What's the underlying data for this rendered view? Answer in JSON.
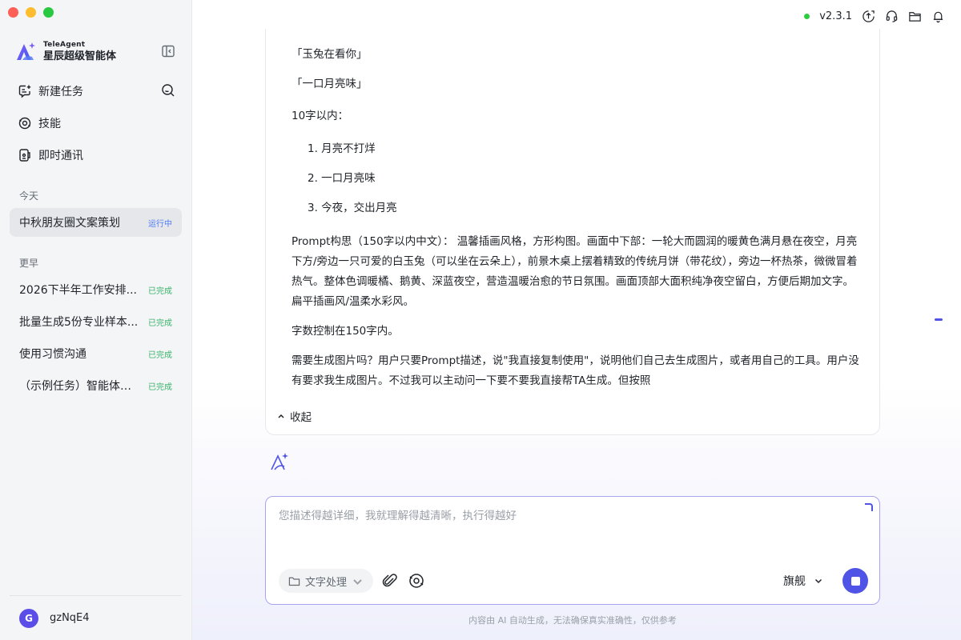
{
  "app": {
    "brand_small": "TeleAgent",
    "brand_big": "星辰超级智能体",
    "version": "v2.3.1",
    "accent_color": "#4f54e6",
    "status_color": "#2ecc40"
  },
  "sidebar": {
    "nav": [
      {
        "label": "新建任务",
        "icon": "new-task-icon"
      },
      {
        "label": "技能",
        "icon": "skill-icon"
      },
      {
        "label": "即时通讯",
        "icon": "chat-icon"
      }
    ],
    "today_label": "今天",
    "earlier_label": "更早",
    "today_tasks": [
      {
        "name": "中秋朋友圈文案策划",
        "status": "运行中"
      }
    ],
    "earlier_tasks": [
      {
        "name": "2026下半年工作安排...",
        "status": "已完成"
      },
      {
        "name": "批量生成5份专业样本...",
        "status": "已完成"
      },
      {
        "name": "使用习惯沟通",
        "status": "已完成"
      },
      {
        "name": "（示例任务）智能体招...",
        "status": "已完成"
      }
    ],
    "user": {
      "avatar_letter": "G",
      "name": "gzNqE4"
    }
  },
  "message": {
    "line1": "「玉兔在看你」",
    "line2": "「一口月亮味」",
    "line3": "10字以内：",
    "list": [
      "1. 月亮不打烊",
      "2. 一口月亮味",
      "3. 今夜，交出月亮"
    ],
    "prompt_para": "Prompt构思（150字以内中文）： 温馨插画风格，方形构图。画面中下部：一轮大而圆润的暖黄色满月悬在夜空，月亮下方/旁边一只可爱的白玉兔（可以坐在云朵上），前景木桌上摆着精致的传统月饼（带花纹），旁边一杯热茶，微微冒着热气。整体色调暖橘、鹅黄、深蓝夜空，营造温暖治愈的节日氛围。画面顶部大面积纯净夜空留白，方便后期加文字。扁平插画风/温柔水彩风。",
    "word_limit": "字数控制在150字内。",
    "final_para": "需要生成图片吗？用户只要Prompt描述，说\"我直接复制使用\"，说明他们自己去生成图片，或者用自己的工具。用户没有要求我生成图片。不过我可以主动问一下要不要我直接帮TA生成。但按照",
    "collapse_label": "收起"
  },
  "composer": {
    "placeholder": "您描述得越详细，我就理解得越清晰，执行得越好",
    "tool_chip": "文字处理",
    "model": "旗舰"
  },
  "footer": {
    "note": "内容由 AI 自动生成，无法确保真实准确性，仅供参考"
  }
}
